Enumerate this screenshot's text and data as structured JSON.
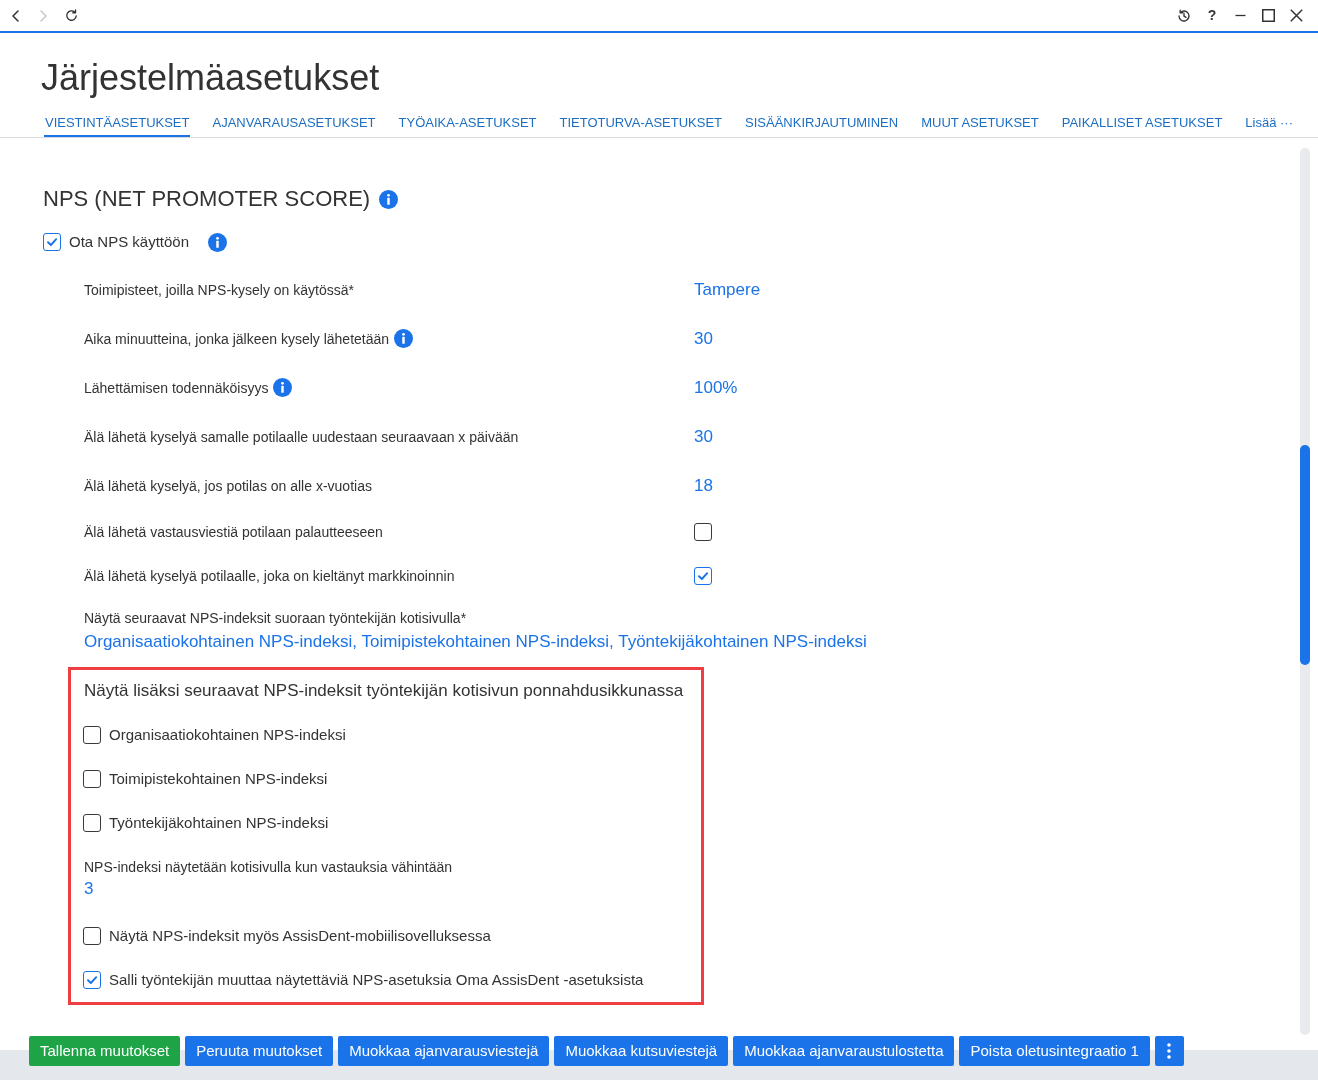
{
  "browser_bar": {
    "nav_buttons": [
      {
        "kind": "back",
        "disabled": false
      },
      {
        "kind": "forward",
        "disabled": true
      },
      {
        "kind": "refresh",
        "disabled": false
      }
    ],
    "window_buttons": [
      {
        "kind": "history"
      },
      {
        "kind": "help",
        "label": "?"
      },
      {
        "kind": "minimize"
      },
      {
        "kind": "maximize"
      },
      {
        "kind": "close"
      }
    ]
  },
  "title": "Järjestelmäasetukset",
  "tabs": [
    {
      "label": "VIESTINTÄASETUKSET",
      "selected": true
    },
    {
      "label": "AJANVARAUSASETUKSET",
      "selected": false
    },
    {
      "label": "TYÖAIKA-ASETUKSET",
      "selected": false
    },
    {
      "label": "TIETOTURVA-ASETUKSET",
      "selected": false
    },
    {
      "label": "SISÄÄNKIRJAUTUMINEN",
      "selected": false
    },
    {
      "label": "MUUT ASETUKSET",
      "selected": false
    },
    {
      "label": "PAIKALLISET ASETUKSET",
      "selected": false
    },
    {
      "label": "Lisää ···",
      "selected": false
    }
  ],
  "section": {
    "title": "NPS (NET PROMOTER SCORE)",
    "info": true,
    "enable": {
      "label": "Ota NPS käyttöön",
      "checked": true,
      "info": true
    },
    "settings": [
      {
        "kind": "value",
        "label": "Toimipisteet, joilla NPS-kysely on käytössä*",
        "info": false,
        "value": "Tampere"
      },
      {
        "kind": "value",
        "label": "Aika minuutteina, jonka jälkeen kysely lähetetään",
        "info": true,
        "value": "30"
      },
      {
        "kind": "value",
        "label": "Lähettämisen todennäköisyys",
        "info": true,
        "value": "100%"
      },
      {
        "kind": "value",
        "label": "Älä lähetä kyselyä samalle potilaalle uudestaan seuraavaan x päivään",
        "info": false,
        "value": "30"
      },
      {
        "kind": "value",
        "label": "Älä lähetä kyselyä, jos potilas on alle x-vuotias",
        "info": false,
        "value": "18"
      },
      {
        "kind": "checkbox",
        "label": "Älä lähetä vastausviestiä potilaan palautteeseen",
        "info": false,
        "checked": false
      },
      {
        "kind": "checkbox",
        "label": "Älä lähetä kyselyä potilaalle, joka on kieltänyt markkinoinnin",
        "info": false,
        "checked": true
      }
    ],
    "home_indexes": {
      "label": "Näytä seuraavat NPS-indeksit suoraan työntekijän kotisivulla*",
      "value": "Organisaatiokohtainen NPS-indeksi, Toimipistekohtainen NPS-indeksi, Työntekijäkohtainen NPS-indeksi"
    },
    "popup_settings": {
      "highlighted": true,
      "title": "Näytä lisäksi seuraavat NPS-indeksit työntekijän kotisivun ponnahdusikkunassa",
      "items": [
        {
          "kind": "checkbox",
          "label": "Organisaatiokohtainen NPS-indeksi",
          "checked": false
        },
        {
          "kind": "checkbox",
          "label": "Toimipistekohtainen NPS-indeksi",
          "checked": false
        },
        {
          "kind": "checkbox",
          "label": "Työntekijäkohtainen NPS-indeksi",
          "checked": false
        },
        {
          "kind": "value",
          "label": "NPS-indeksi näytetään kotisivulla kun vastauksia vähintään",
          "value": "3"
        },
        {
          "kind": "checkbox",
          "label": "Näytä NPS-indeksit myös AssisDent-mobiilisovelluksessa",
          "checked": false
        },
        {
          "kind": "checkbox",
          "label": "Salli työntekijän muuttaa näytettäviä NPS-asetuksia Oma AssisDent -asetuksista",
          "checked": true
        }
      ]
    }
  },
  "buttons": [
    {
      "kind": "success",
      "label": "Tallenna muutokset"
    },
    {
      "kind": "primary",
      "label": "Peruuta muutokset"
    },
    {
      "kind": "primary",
      "label": "Muokkaa ajanvarausviestejä"
    },
    {
      "kind": "primary",
      "label": "Muokkaa kutsuviestejä"
    },
    {
      "kind": "primary",
      "label": "Muokkaa ajanvaraustulostetta"
    },
    {
      "kind": "primary",
      "label": "Poista oletusintegraatio 1"
    },
    {
      "kind": "menu"
    }
  ]
}
